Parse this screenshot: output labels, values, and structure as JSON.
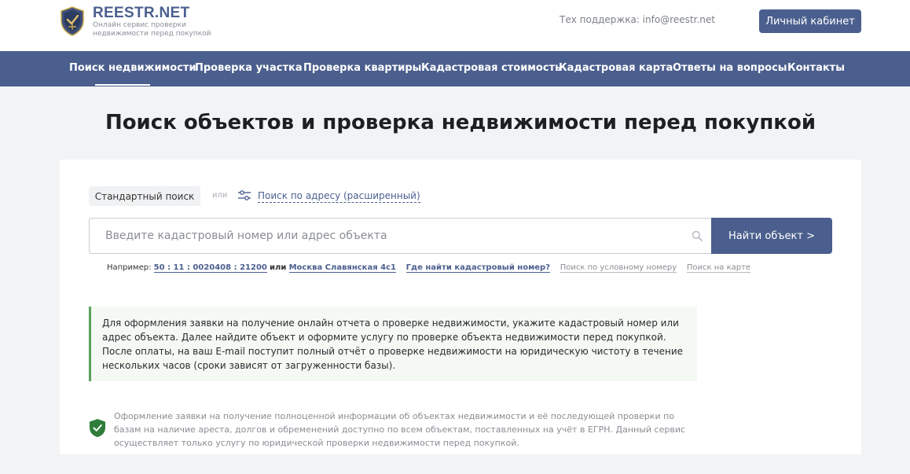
{
  "header": {
    "brand": "REESTR.NET",
    "tagline": "Онлайн сервис проверки недвижимости перед покупкой",
    "support": "Тех поддержка: info@reestr.net",
    "cabinet_label": "Личный кабинет"
  },
  "nav": {
    "items": [
      {
        "label": "Поиск недвижимости"
      },
      {
        "label": "Проверка участка"
      },
      {
        "label": "Проверка квартиры"
      },
      {
        "label": "Кадастровая стоимость"
      },
      {
        "label": "Кадастровая карта"
      },
      {
        "label": "Ответы на вопросы"
      },
      {
        "label": "Контакты"
      }
    ],
    "active_index": 0
  },
  "page_title": "Поиск объектов и проверка недвижимости перед покупкой",
  "search": {
    "standard_label": "Стандартный поиск",
    "or_word": "или",
    "advanced_label": "Поиск по адресу (расширенный)",
    "placeholder": "Введите кадастровый номер или адрес объекта",
    "value": "",
    "find_label": "Найти объект >"
  },
  "examples": {
    "prefix": "Например:",
    "cadastral_example": "50 : 11 : 0020408 : 21200",
    "or_word": "или",
    "address_example": "Москва Славянская 4с1",
    "where_find": "Где найти кадастровый номер?",
    "conditional_search": "Поиск по условному номеру",
    "map_search": "Поиск на карте"
  },
  "info_text": "Для оформления заявки на получение онлайн отчета о проверке недвижимости, укажите кадастровый номер или адрес объекта. Далее найдите объект и оформите услугу по проверке объекта недвижимости перед покупкой. После оплаты, на ваш E-mail поступит полный отчёт о проверке недвижимости на юридическую чистоту в течение нескольких часов (сроки зависят от загруженности базы).",
  "footer_note": "Оформление заявки на получение полноценной информации об объектах недвижимости и её последующей проверки по базам на наличие ареста, долгов и обременений доступно по всем объектам, поставленных на учёт в ЕГРН. Данный сервис осуществляет только услугу по юридической проверки недвижимости перед покупкой.",
  "icons": {
    "logo": "shield-logo-icon",
    "sliders": "sliders-icon",
    "search": "search-icon",
    "check_shield": "shield-check-icon"
  },
  "colors": {
    "brand": "#4b5f8e",
    "success": "#2e7d3a",
    "info_bg": "#f4f9f4"
  }
}
